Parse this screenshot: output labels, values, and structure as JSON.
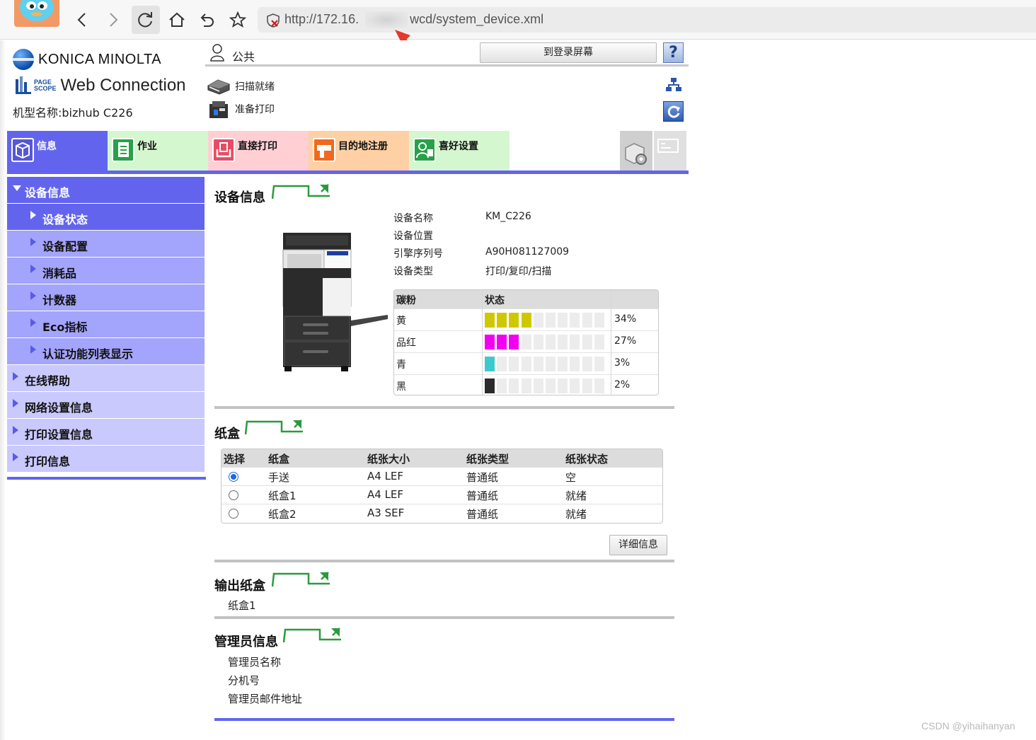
{
  "browser": {
    "url_prefix": "http://172.16.",
    "url_suffix": "wcd/system_device.xml",
    "icons": [
      "back-icon",
      "forward-icon",
      "reload-icon",
      "home-icon",
      "undo-icon",
      "star-icon",
      "insecure-icon"
    ]
  },
  "header": {
    "brand": "KONICA MINOLTA",
    "pagescope_line1": "PAGE",
    "pagescope_line2": "SCOPE",
    "product": "Web Connection",
    "model_label": "机型名称:bizhub C226",
    "user": "公共",
    "login_button": "到登录屏幕",
    "help_button": "?",
    "scan_status": "扫描就绪",
    "print_status": "准备打印"
  },
  "tabs": [
    {
      "label": "信息",
      "color": "#6364ee"
    },
    {
      "label": "作业",
      "color": "#d5f7cf"
    },
    {
      "label": "直接打印",
      "color": "#ffcfd3"
    },
    {
      "label": "目的地注册",
      "color": "#ffd0a3"
    },
    {
      "label": "喜好设置",
      "color": "#d5f7cf"
    }
  ],
  "sidebar": [
    {
      "label": "设备信息",
      "level": 1,
      "state": "open"
    },
    {
      "label": "设备状态",
      "level": 2,
      "state": "active"
    },
    {
      "label": "设备配置",
      "level": 2
    },
    {
      "label": "消耗品",
      "level": 2
    },
    {
      "label": "计数器",
      "level": 2
    },
    {
      "label": "Eco指标",
      "level": 2
    },
    {
      "label": "认证功能列表显示",
      "level": 2
    },
    {
      "label": "在线帮助",
      "level": 1
    },
    {
      "label": "网络设置信息",
      "level": 1
    },
    {
      "label": "打印设置信息",
      "level": 1
    },
    {
      "label": "打印信息",
      "level": 1
    }
  ],
  "device_info": {
    "title": "设备信息",
    "fields": [
      {
        "label": "设备名称",
        "value": "KM_C226"
      },
      {
        "label": "设备位置",
        "value": ""
      },
      {
        "label": "引擎序列号",
        "value": "A90H081127009"
      },
      {
        "label": "设备类型",
        "value": "打印/复印/扫描"
      }
    ],
    "toner_header": {
      "col1": "碳粉",
      "col2": "状态"
    },
    "toner": [
      {
        "name": "黄",
        "percent": 34,
        "filled": 4,
        "label": "34%",
        "color": "#cfc800"
      },
      {
        "name": "品红",
        "percent": 27,
        "filled": 3,
        "label": "27%",
        "color": "#f200f2"
      },
      {
        "name": "青",
        "percent": 3,
        "filled": 1,
        "label": "3%",
        "color": "#3ec9cf"
      },
      {
        "name": "黑",
        "percent": 2,
        "filled": 1,
        "label": "2%",
        "color": "#2b2b2b"
      }
    ],
    "toner_segments": 10
  },
  "paper_tray": {
    "title": "纸盒",
    "columns": [
      "选择",
      "纸盒",
      "纸张大小",
      "纸张类型",
      "纸张状态"
    ],
    "rows": [
      {
        "selected": true,
        "tray": "手送",
        "size": "A4 LEF",
        "type": "普通纸",
        "status": "空"
      },
      {
        "selected": false,
        "tray": "纸盒1",
        "size": "A4 LEF",
        "type": "普通纸",
        "status": "就绪"
      },
      {
        "selected": false,
        "tray": "纸盒2",
        "size": "A3 SEF",
        "type": "普通纸",
        "status": "就绪"
      }
    ],
    "detail_button": "详细信息"
  },
  "output_tray": {
    "title": "输出纸盒",
    "item": "纸盒1"
  },
  "admin_info": {
    "title": "管理员信息",
    "fields": [
      "管理员名称",
      "分机号",
      "管理员邮件地址"
    ]
  },
  "watermark": "CSDN @yihaihanyan"
}
